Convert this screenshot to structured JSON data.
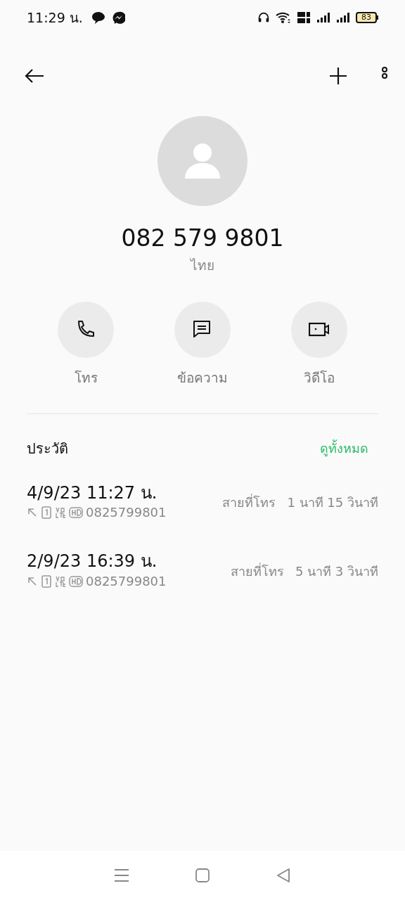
{
  "status_bar": {
    "time": "11:29 น.",
    "battery": "83"
  },
  "contact": {
    "number": "082 579 9801",
    "location": "ไทย"
  },
  "actions": [
    {
      "kind": "call",
      "label": "โทร"
    },
    {
      "kind": "message",
      "label": "ข้อความ"
    },
    {
      "kind": "video",
      "label": "วิดีโอ"
    }
  ],
  "history": {
    "title": "ประวัติ",
    "view_all": "ดูทั้งหมด",
    "calls": [
      {
        "datetime": "4/9/23 11:27 น.",
        "number": "0825799801",
        "type": "สายที่โทร",
        "duration": "1 นาที 15 วินาที"
      },
      {
        "datetime": "2/9/23 16:39 น.",
        "number": "0825799801",
        "type": "สายที่โทร",
        "duration": "5 นาที 3 วินาที"
      }
    ]
  }
}
